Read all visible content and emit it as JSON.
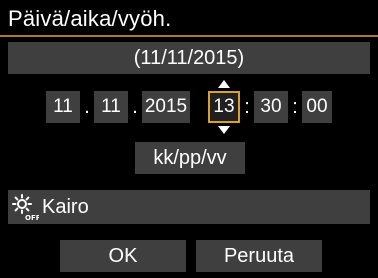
{
  "title": "Päivä/aika/vyöh.",
  "date_display": "(11/11/2015)",
  "fields": {
    "day": "11",
    "month": "11",
    "year": "2015",
    "hour": "13",
    "minute": "30",
    "second": "00"
  },
  "separators": {
    "date": ".",
    "time": ":"
  },
  "format": "kk/pp/vv",
  "time_zone": {
    "icon": "dst-off-icon",
    "name": "Kairo"
  },
  "buttons": {
    "ok": "OK",
    "cancel": "Peruuta"
  },
  "colors": {
    "accent": "#d9a12a",
    "rule": "#b07a24",
    "field_bg": "#3f3f3f",
    "background": "#000000"
  }
}
